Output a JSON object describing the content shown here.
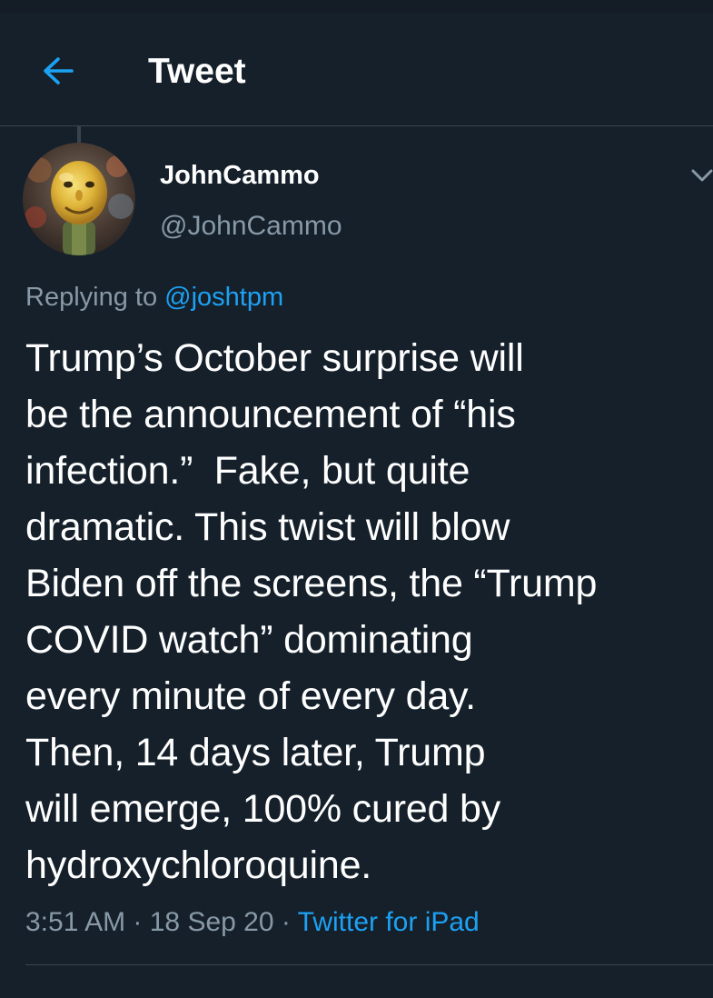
{
  "colors": {
    "background": "#15202b",
    "accent": "#1da1f2",
    "secondary_text": "#8899a6",
    "divider": "#38444d"
  },
  "header": {
    "back_icon": "arrow-left-icon",
    "title": "Tweet"
  },
  "tweet": {
    "author": {
      "display_name": "JohnCammo",
      "handle": "@JohnCammo",
      "avatar": "avatar-image"
    },
    "menu_icon": "chevron-down-icon",
    "replying_prefix": "Replying to ",
    "replying_handle": "@joshtpm",
    "text_lines": [
      "Trump’s October surprise will",
      "be the announcement of “his",
      "infection.”  Fake, but quite",
      "dramatic. This twist will blow",
      "Biden off the screens, the “Trump",
      "COVID watch” dominating",
      "every minute of every day.",
      "Then, 14 days later, Trump",
      "will emerge, 100% cured by",
      "hydroxychloroquine."
    ],
    "time": "3:51 AM",
    "separator": " · ",
    "date": "18 Sep 20",
    "source": "Twitter for iPad"
  }
}
